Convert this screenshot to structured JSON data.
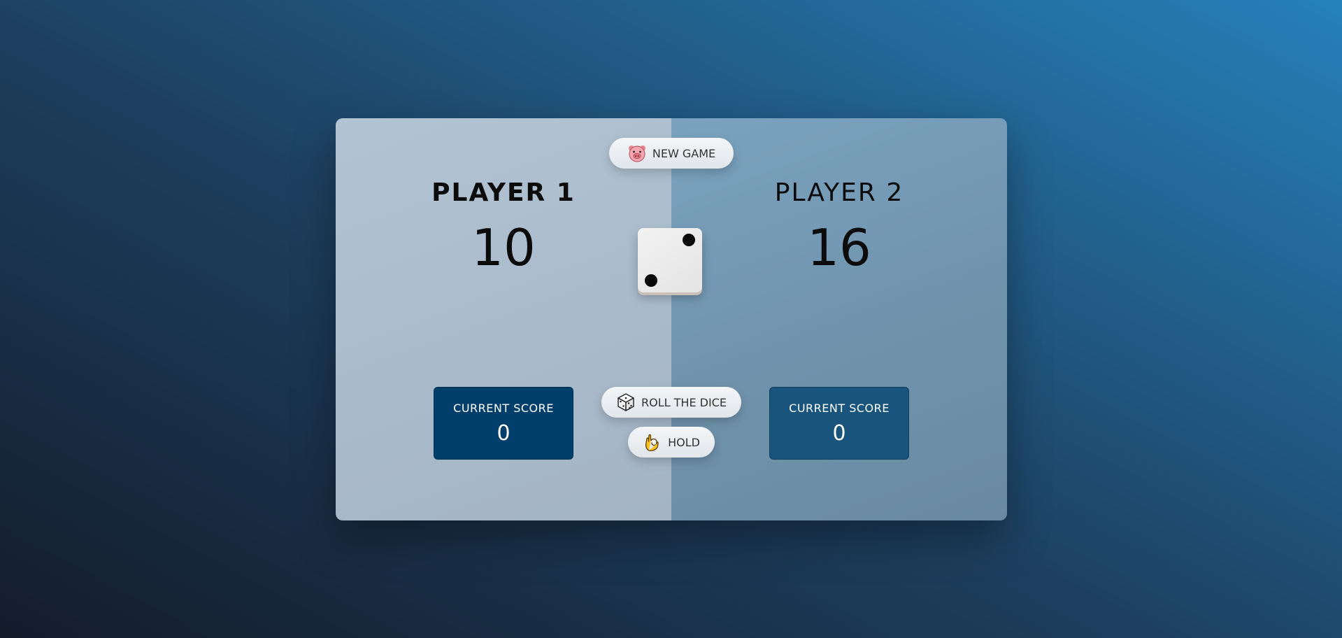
{
  "players": [
    {
      "name": "PLAYER 1",
      "total_score": "10",
      "current_label": "CURRENT SCORE",
      "current_score": "0",
      "active": true
    },
    {
      "name": "PLAYER 2",
      "total_score": "16",
      "current_label": "CURRENT SCORE",
      "current_score": "0",
      "active": false
    }
  ],
  "buttons": {
    "new_game": {
      "label": "NEW GAME",
      "icon": "pig-face-icon"
    },
    "roll": {
      "label": "ROLL THE DICE",
      "icon": "game-die-icon"
    },
    "hold": {
      "label": "HOLD",
      "icon": "ok-hand-icon"
    }
  },
  "dice": {
    "value": 2
  },
  "colors": {
    "active_panel": "#b2c4d2",
    "inactive_panel": "#7aa2bf",
    "current_active": "#003f6b",
    "current_inactive": "#18547c"
  }
}
